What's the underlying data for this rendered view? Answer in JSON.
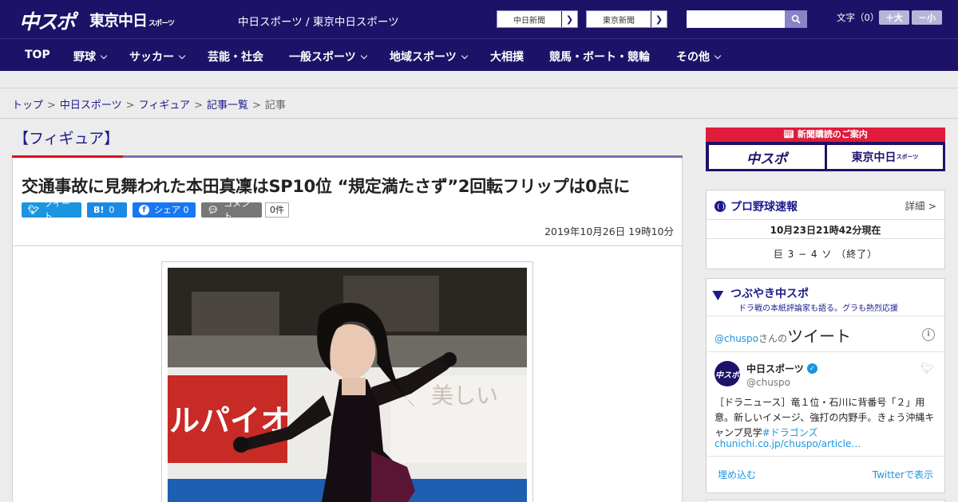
{
  "header": {
    "logo_main": "中スポ",
    "logo_tokyo": "東京中日",
    "logo_tokyo_small": "スポーツ",
    "site_title": "中日スポーツ / 東京中日スポーツ",
    "link_chunichi": "中日新聞",
    "link_tokyo": "東京新聞",
    "search_placeholder": "",
    "font_size_label": "文字（0）",
    "font_larger": "＋大",
    "font_smaller": "－小"
  },
  "nav": {
    "items": [
      {
        "label": "TOP",
        "dropdown": false
      },
      {
        "label": "野球",
        "dropdown": true
      },
      {
        "label": "サッカー",
        "dropdown": true
      },
      {
        "label": "芸能・社会",
        "dropdown": false
      },
      {
        "label": "一般スポーツ",
        "dropdown": true
      },
      {
        "label": "地域スポーツ",
        "dropdown": true
      },
      {
        "label": "大相撲",
        "dropdown": false
      },
      {
        "label": "競馬・ボート・競輪",
        "dropdown": false
      },
      {
        "label": "その他",
        "dropdown": true
      }
    ]
  },
  "breadcrumb": {
    "items": [
      "トップ",
      "中日スポーツ",
      "フィギュア",
      "記事一覧"
    ],
    "current": "記事"
  },
  "article": {
    "category": "【フィギュア】",
    "headline": "交通事故に見舞われた本田真凜はSP10位 “規定満たさず”2回転フリップは0点に",
    "tweet_label": "ツイート",
    "hatena_label": "B!",
    "hatena_count": "0",
    "facebook_label": "シェア",
    "facebook_count": "0",
    "comment_label": "コメント",
    "comment_count": "0件",
    "date": "2019年10月26日 19時10分",
    "photo_banner_text": "ルパイオ",
    "photo_sign_text": "美しい"
  },
  "sidebar": {
    "subscribe_title": "新聞購読のご案内",
    "subscribe_logo_a": "中スポ",
    "subscribe_logo_b": "東京中日",
    "subscribe_logo_b_small": "スポーツ",
    "baseball_title": "プロ野球速報",
    "baseball_detail": "詳細 >",
    "baseball_time": "10月23日21時42分現在",
    "baseball_score": "巨 3 − 4 ソ （終了）",
    "tweets_title": "つぶやき中スポ",
    "tweets_subtitle": "ドラ戦の本紙評論家も語る。グラも熱烈応援",
    "tweets_handle": "@chuspo",
    "tweets_handle_suffix": "さんの",
    "tweets_handle_big": "ツイート",
    "account_name": "中日スポーツ",
    "account_id": "@chuspo",
    "avatar_text": "中スポ",
    "tweet_text": "［ドラニュース］竜１位・石川に背番号「２」用意。新しいイメージ、強打の内野手。きょう沖縄キャンプ見学",
    "tweet_tag": "#ドラゴンズ",
    "tweet_link": "chunichi.co.jp/chuspo/article…",
    "embed_label": "埋め込む",
    "view_label": "Twitterで表示"
  },
  "colors": {
    "brand_navy": "#1c1368",
    "accent_red": "#e00020",
    "twitter_blue": "#1b95e0",
    "facebook_blue": "#1877f2"
  }
}
